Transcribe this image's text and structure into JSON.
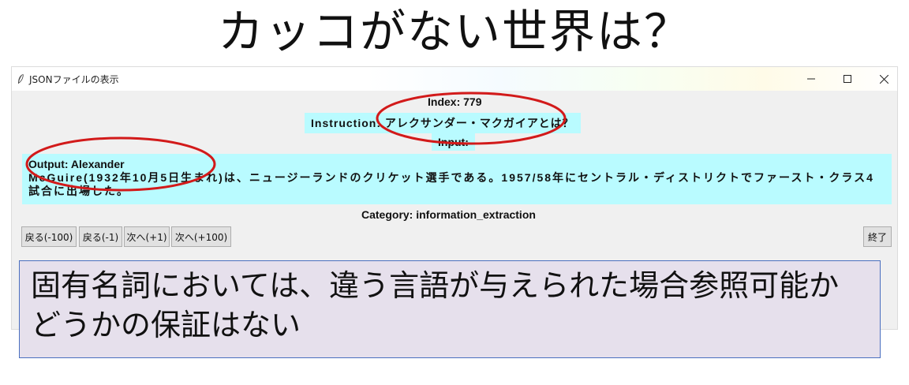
{
  "slide": {
    "title": "カッコがない世界は？",
    "caption": "固有名詞においては、違う言語が与えられた場合参照可能かどうかの保証はない"
  },
  "window": {
    "title": "JSONファイルの表示",
    "controls": {
      "minimize": "—",
      "maximize": "☐",
      "close": "✕"
    }
  },
  "record": {
    "index": "Index: 779",
    "instruction": "Instruction: アレクサンダー・マクガイアとは？",
    "input": "Input:",
    "output_first": "Output: Alexander",
    "output_rest": "McGuire(1932年10月5日生まれ)は、ニュージーランドのクリケット選手である。1957/58年にセントラル・ディストリクトでファースト・クラス4試合に出場した。",
    "category": "Category: information_extraction"
  },
  "buttons": {
    "back100": "戻る(-100)",
    "back1": "戻る(-1)",
    "fwd1": "次へ(+1)",
    "fwd100": "次へ(+100)",
    "quit": "終了"
  },
  "colors": {
    "highlight": "#b9fbff",
    "annotation_ellipse": "#d21a1a",
    "caption_bg": "#e6e0ec",
    "caption_border": "#4a6fbf"
  }
}
